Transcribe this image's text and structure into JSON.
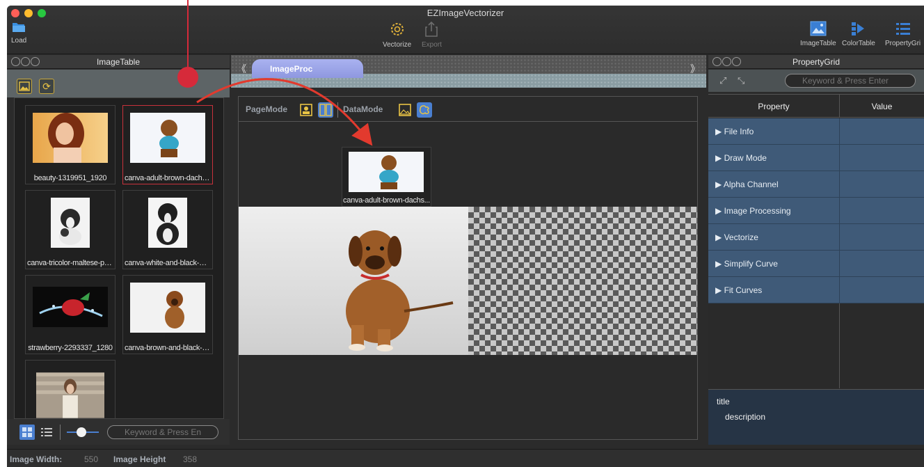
{
  "window": {
    "title": "EZImageVectorizer"
  },
  "toolbar": {
    "load_label": "Load",
    "vectorize_label": "Vectorize",
    "export_label": "Export",
    "imagetable_label": "ImageTable",
    "colortable_label": "ColorTable",
    "propertygrid_label": "PropertyGri"
  },
  "image_table": {
    "title": "ImageTable",
    "search_placeholder": "Keyword & Press En",
    "items": [
      {
        "caption": "beauty-1319951_1920",
        "selected": false
      },
      {
        "caption": "canva-adult-brown-dachs...",
        "selected": true
      },
      {
        "caption": "canva-tricolor-maltese-pu...",
        "selected": false
      },
      {
        "caption": "canva-white-and-black-m...",
        "selected": false
      },
      {
        "caption": "strawberry-2293337_1280",
        "selected": false
      },
      {
        "caption": "canva-brown-and-black-g...",
        "selected": false
      },
      {
        "caption": "",
        "selected": false
      }
    ]
  },
  "center": {
    "tab_label": "ImageProc",
    "page_mode_label": "PageMode",
    "data_mode_label": "DataMode",
    "current_image_caption": "canva-adult-brown-dachs..."
  },
  "property_grid": {
    "title": "PropertyGrid",
    "search_placeholder": "Keyword & Press Enter",
    "col_property": "Property",
    "col_value": "Value",
    "rows": [
      {
        "name": "File Info",
        "value": ""
      },
      {
        "name": "Draw Mode",
        "value": ""
      },
      {
        "name": "Alpha Channel",
        "value": ""
      },
      {
        "name": "Image Processing",
        "value": ""
      },
      {
        "name": "Vectorize",
        "value": ""
      },
      {
        "name": "Simplify Curve",
        "value": ""
      },
      {
        "name": "Fit Curves",
        "value": ""
      }
    ],
    "desc_title": "title",
    "desc_text": "description"
  },
  "status": {
    "width_label": "Image Width:",
    "width_value": "550",
    "height_label": "Image Height",
    "height_value": "358"
  },
  "colors": {
    "accent_blue": "#4a7fd0",
    "selection_red": "#c8323c",
    "annotation_red": "#d62a3a",
    "property_row": "#3f5a78"
  },
  "icons": {
    "load": "folder-icon",
    "vectorize": "gear-icon",
    "export": "share-icon",
    "imagetable": "image-icon",
    "colortable": "palette-icon",
    "propertygrid": "list-icon"
  }
}
